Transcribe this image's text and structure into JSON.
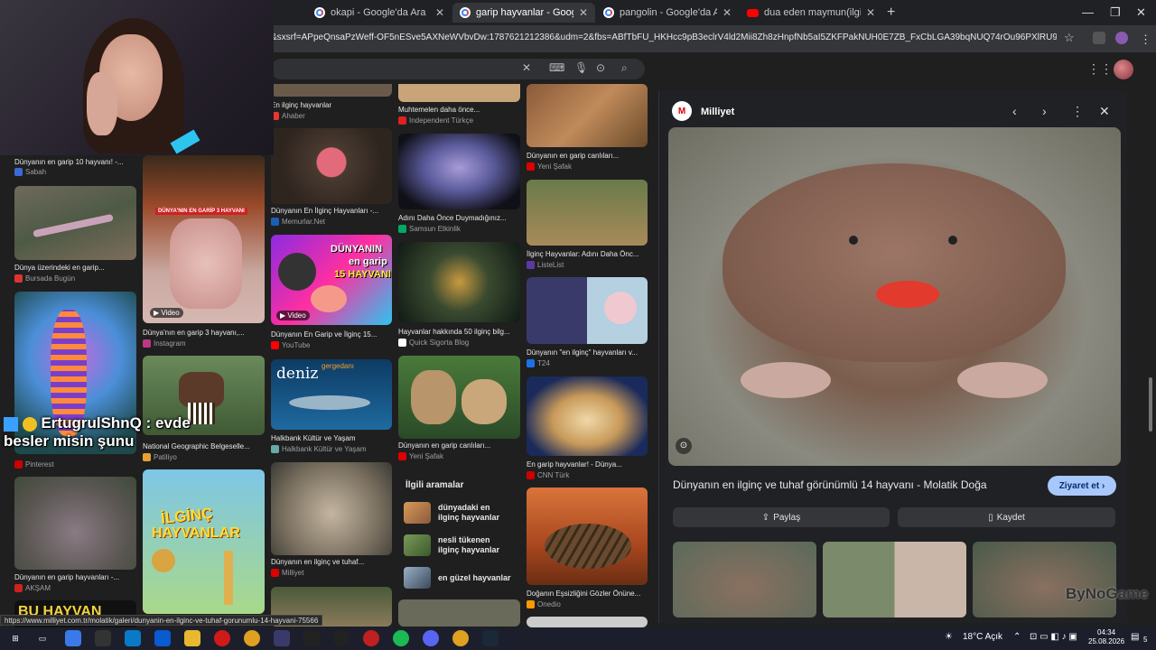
{
  "tabs": [
    {
      "title": "okapi - Google'da Ara",
      "icon": "google-icon"
    },
    {
      "title": "garip hayvanlar - Google'da Ara",
      "icon": "google-icon"
    },
    {
      "title": "pangolin - Google'da Ara",
      "icon": "google-icon"
    },
    {
      "title": "dua eden maymun(ilginç sesler",
      "icon": "youtube-icon"
    }
  ],
  "address_url": "&sxsrf=APpeQnsaPzWeff-OF5nESve5AXNeWVbvDw:1787621212386&udm=2&fbs=ABfTbFU_HKHcc9pB3eclrV4ld2Mii8Zh8zHnpfNb5aI5ZKFPakNUH0E7ZB_FxCbLGA39bqNUQ74rOu96PXlRU9PLGGe6qOJflt8cM...",
  "results": [
    {
      "caption": "En ilginç hayvanlar",
      "source": "Ahaber"
    },
    {
      "caption": "Muhtemelen daha önce...",
      "source": "Independent Türkçe"
    },
    {
      "caption": "Dünyanın en garip canlıları...",
      "source": "Yeni Şafak"
    },
    {
      "caption": "Dünyanın en garip 10 hayvanı! -...",
      "source": "Sabah"
    },
    {
      "caption": "Dünyanın En İlginç Hayvanları -...",
      "source": "Memurlar.Net"
    },
    {
      "caption": "Adını Daha Önce Duymadığınız...",
      "source": "Samsun Etkinlik"
    },
    {
      "caption": "İlginç Hayvanlar: Adını Daha Önc...",
      "source": "ListeList"
    },
    {
      "caption": "Dünya üzerindeki en garip...",
      "source": "Bursada Bugün"
    },
    {
      "caption": "Dünya'nın en garip 3 hayvanı,...",
      "source": "Instagram"
    },
    {
      "caption": "Dünyanın En Garip ve İlginç 15...",
      "source": "YouTube"
    },
    {
      "caption": "Hayvanlar hakkında 50 ilginç bilg...",
      "source": "Quick Sigorta Blog"
    },
    {
      "caption": "Dünyanın \"en ilginç\" hayvanları v...",
      "source": "T24"
    },
    {
      "caption": "Halkbank Kültür ve Yaşam",
      "source": "Halkbank Kültür ve Yaşam"
    },
    {
      "caption": "National Geographic Belgeselle...",
      "source": "Patiliyo"
    },
    {
      "caption": "Dünyanın en garip canlıları...",
      "source": "Yeni Şafak"
    },
    {
      "caption": "En garip hayvanlar! - Dünya...",
      "source": "CNN Türk"
    },
    {
      "caption": "Dünyanın en garip hayvanları -...",
      "source": "AKŞAM"
    },
    {
      "caption": "Dünyanın en ilginç ve tuhaf...",
      "source": "Milliyet"
    },
    {
      "caption": "Doğanın Eşsizliğini Gözler Önüne...",
      "source": "Onedio"
    },
    {
      "caption": "",
      "source": "Pinterest"
    }
  ],
  "video_badge": "Video",
  "img_texts": {
    "rooster": "DÜNYA'NIN EN GARİP 3 HAYVANI",
    "yt_line1": "DÜNYANIN",
    "yt_line2": "en garip",
    "yt_line3": "15 HAYVANI",
    "deniz": "deniz",
    "gergedani": "gergedanı",
    "ilginc": "İLGİNÇ",
    "hayvanlar": "HAYVANLAR",
    "bu_hayvan": "BU HAYVAN"
  },
  "related": {
    "title": "İlgili aramalar",
    "items": [
      "dünyadaki en ilginç hayvanlar",
      "nesli tükenen ilginç hayvanlar",
      "en güzel hayvanlar"
    ]
  },
  "panel": {
    "source": "Milliyet",
    "title": "Dünyanın en ilginç ve tuhaf görünümlü 14 hayvanı - Molatik Doğa",
    "visit": "Ziyaret et",
    "share": "Paylaş",
    "save": "Kaydet"
  },
  "chat": {
    "user": "ErtugrulShnQ",
    "message": ": evde",
    "message2": "besler misin şunu"
  },
  "status_url": "https://www.milliyet.com.tr/molatik/galeri/dunyanin-en-ilginc-ve-tuhaf-gorunumlu-14-hayvani-75566",
  "watermark": "ByNoGame",
  "weather": "18°C Açık",
  "clock": {
    "time": "04:34",
    "date": "25.08.2026"
  },
  "notif_count": "5"
}
